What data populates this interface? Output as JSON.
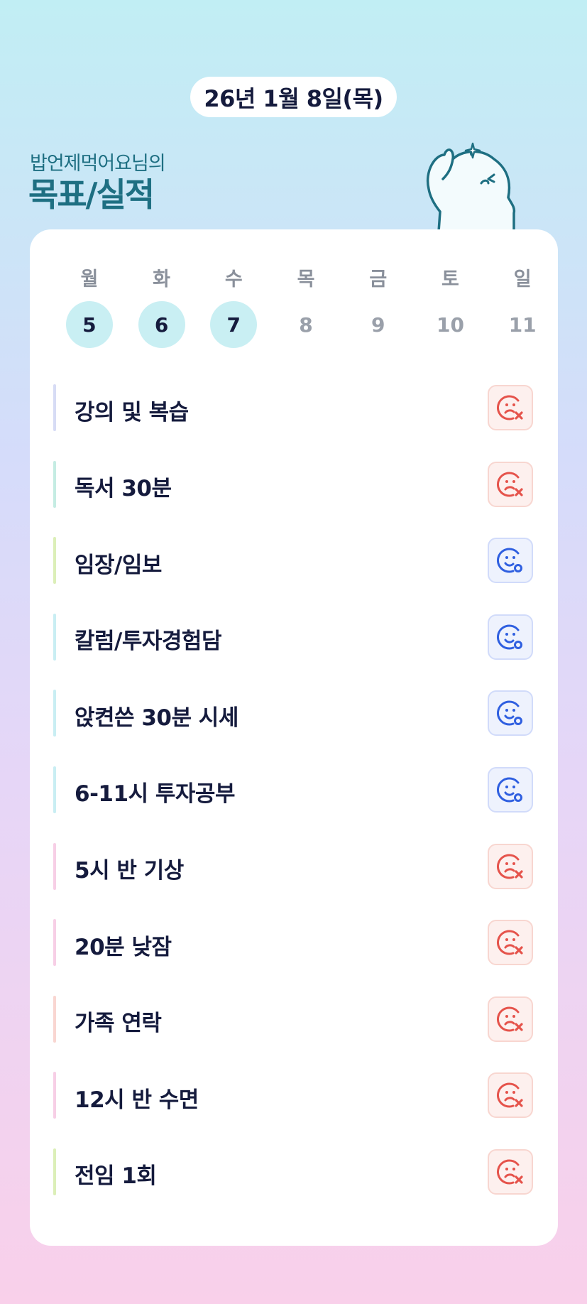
{
  "header": {
    "date": "26년 1월 8일(목)",
    "owner": "밥언제먹어요님의",
    "title": "목표/실적"
  },
  "week": [
    {
      "name": "월",
      "num": "5",
      "active": true
    },
    {
      "name": "화",
      "num": "6",
      "active": true
    },
    {
      "name": "수",
      "num": "7",
      "active": true
    },
    {
      "name": "목",
      "num": "8",
      "active": false
    },
    {
      "name": "금",
      "num": "9",
      "active": false
    },
    {
      "name": "토",
      "num": "10",
      "active": false
    },
    {
      "name": "일",
      "num": "11",
      "active": false
    }
  ],
  "goals": [
    {
      "label": "강의 및 복습",
      "status": "fail",
      "bar_color": "#d7dcf5"
    },
    {
      "label": "독서 30분",
      "status": "fail",
      "bar_color": "#c5ece3"
    },
    {
      "label": "임장/임보",
      "status": "done",
      "bar_color": "#dcefb8"
    },
    {
      "label": "칼럼/투자경험담",
      "status": "done",
      "bar_color": "#c9eef3"
    },
    {
      "label": "앉켠쓴 30분 시세",
      "status": "done",
      "bar_color": "#c9eef3"
    },
    {
      "label": "6-11시 투자공부",
      "status": "done",
      "bar_color": "#c9eef3"
    },
    {
      "label": "5시 반 기상",
      "status": "fail",
      "bar_color": "#f7cfe6"
    },
    {
      "label": "20분 낮잠",
      "status": "fail",
      "bar_color": "#f7cfe6"
    },
    {
      "label": "가족 연락",
      "status": "fail",
      "bar_color": "#f9d6d1"
    },
    {
      "label": "12시 반 수면",
      "status": "fail",
      "bar_color": "#f7cfe6"
    },
    {
      "label": "전임 1회",
      "status": "fail",
      "bar_color": "#dcefb8"
    }
  ],
  "icons": {
    "fail": "sad-face-x-icon",
    "done": "smile-face-o-icon"
  },
  "colors": {
    "fail": "#e5534b",
    "done": "#2f5fe0",
    "title": "#1e6f82",
    "active_day": "#c9eff3"
  }
}
